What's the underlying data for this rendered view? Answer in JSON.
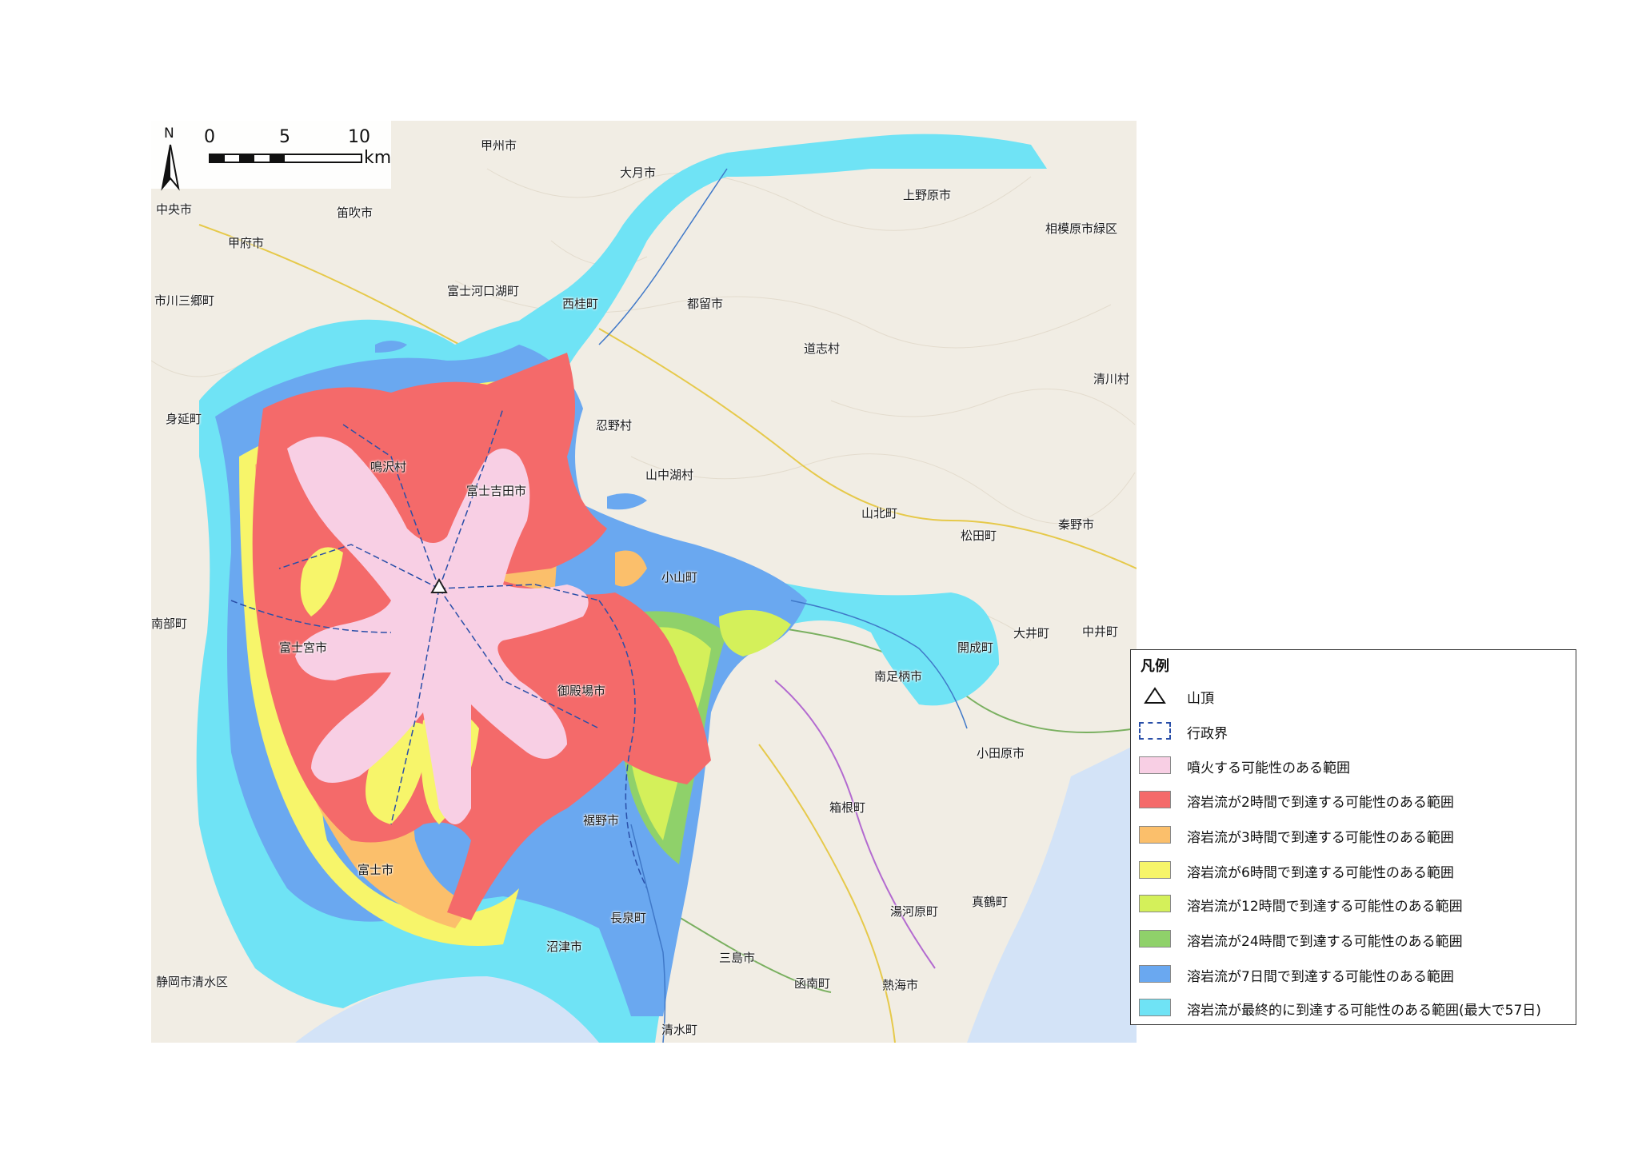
{
  "scale_bar": {
    "ticks": [
      "0",
      "5",
      "10"
    ],
    "unit": "km",
    "north": "N"
  },
  "summit_symbol": "triangle-icon",
  "colors": {
    "eruption": "#f8cfe4",
    "lava_2h": "#f46a6a",
    "lava_3h": "#fbbf6b",
    "lava_6h": "#f7f56a",
    "lava_12h": "#d4f05a",
    "lava_24h": "#8fd16a",
    "lava_7d": "#6aa8f0",
    "lava_final": "#6fe3f5",
    "sea": "#d3e3f7"
  },
  "places": [
    {
      "name": "甲州市"
    },
    {
      "name": "大月市"
    },
    {
      "name": "上野原市"
    },
    {
      "name": "相模原市緑区"
    },
    {
      "name": "中央市"
    },
    {
      "name": "笛吹市"
    },
    {
      "name": "甲府市"
    },
    {
      "name": "市川三郷町"
    },
    {
      "name": "富士河口湖町"
    },
    {
      "name": "西桂町"
    },
    {
      "name": "都留市"
    },
    {
      "name": "道志村"
    },
    {
      "name": "清川村"
    },
    {
      "name": "身延町"
    },
    {
      "name": "忍野村"
    },
    {
      "name": "鳴沢村"
    },
    {
      "name": "富士吉田市"
    },
    {
      "name": "山中湖村"
    },
    {
      "name": "山北町"
    },
    {
      "name": "松田町"
    },
    {
      "name": "秦野市"
    },
    {
      "name": "小山町"
    },
    {
      "name": "南部町"
    },
    {
      "name": "富士宮市"
    },
    {
      "name": "大井町"
    },
    {
      "name": "中井町"
    },
    {
      "name": "開成町"
    },
    {
      "name": "南足柄市"
    },
    {
      "name": "御殿場市"
    },
    {
      "name": "小田原市"
    },
    {
      "name": "箱根町"
    },
    {
      "name": "裾野市"
    },
    {
      "name": "富士市"
    },
    {
      "name": "湯河原町"
    },
    {
      "name": "真鶴町"
    },
    {
      "name": "長泉町"
    },
    {
      "name": "沼津市"
    },
    {
      "name": "三島市"
    },
    {
      "name": "静岡市清水区"
    },
    {
      "name": "函南町"
    },
    {
      "name": "熱海市"
    },
    {
      "name": "清水町"
    }
  ],
  "legend": {
    "title": "凡例",
    "items": [
      {
        "label": "山頂",
        "swatch": "summit"
      },
      {
        "label": "行政界",
        "swatch": "boundary"
      },
      {
        "label": "噴火する可能性のある範囲",
        "swatch": "#f8cfe4"
      },
      {
        "label": "溶岩流が2時間で到達する可能性のある範囲",
        "swatch": "#f46a6a"
      },
      {
        "label": "溶岩流が3時間で到達する可能性のある範囲",
        "swatch": "#fbbf6b"
      },
      {
        "label": "溶岩流が6時間で到達する可能性のある範囲",
        "swatch": "#f7f56a"
      },
      {
        "label": "溶岩流が12時間で到達する可能性のある範囲",
        "swatch": "#d4f05a"
      },
      {
        "label": "溶岩流が24時間で到達する可能性のある範囲",
        "swatch": "#8fd16a"
      },
      {
        "label": "溶岩流が7日間で到達する可能性のある範囲",
        "swatch": "#6aa8f0"
      },
      {
        "label": "溶岩流が最終的に到達する可能性のある範囲(最大で57日)",
        "swatch": "#6fe3f5"
      }
    ]
  }
}
